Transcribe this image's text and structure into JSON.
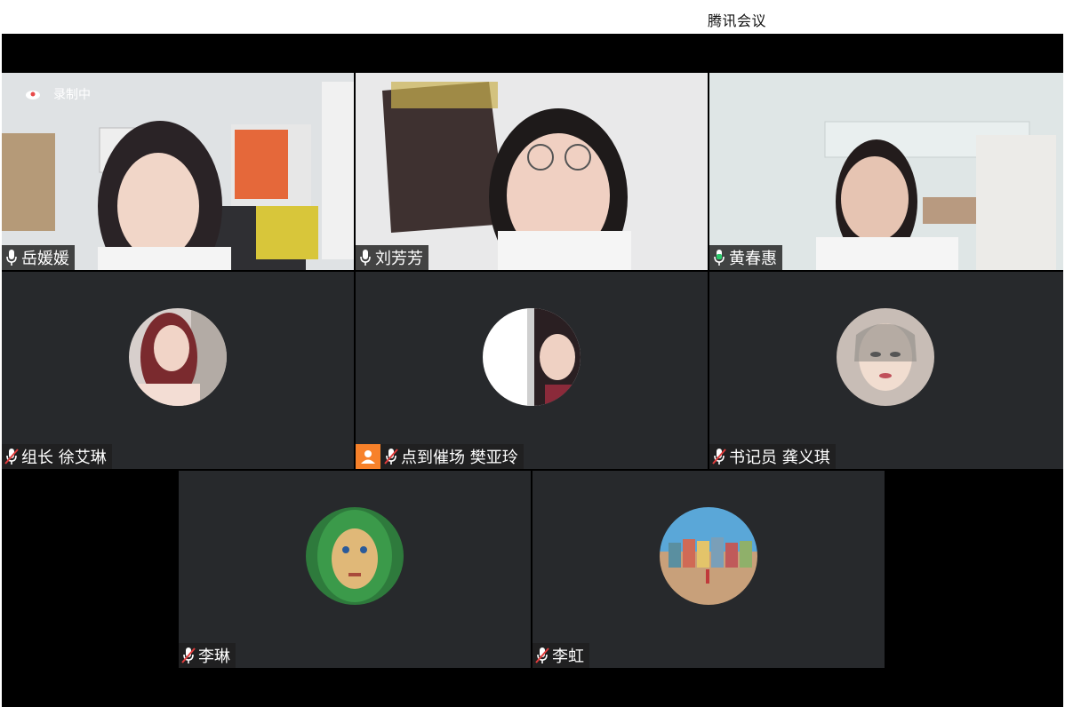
{
  "app": {
    "title": "腾讯会议"
  },
  "recording": {
    "label": "录制中"
  },
  "participants": [
    {
      "name": "岳媛媛",
      "mic": "on"
    },
    {
      "name": "刘芳芳",
      "mic": "on"
    },
    {
      "name": "黄春惠",
      "mic": "speaking"
    },
    {
      "name": "组长 徐艾琳",
      "mic": "muted"
    },
    {
      "name": "点到催场 樊亚玲",
      "mic": "muted",
      "role": "host"
    },
    {
      "name": "书记员 龚义琪",
      "mic": "muted"
    },
    {
      "name": "李琳",
      "mic": "muted"
    },
    {
      "name": "李虹",
      "mic": "muted"
    }
  ],
  "colors": {
    "stage_bg": "#000000",
    "tile_bg": "#27292c",
    "speaking_border": "#2bc96b",
    "host_badge": "#f7812a",
    "muted_red": "#e03c3c"
  }
}
